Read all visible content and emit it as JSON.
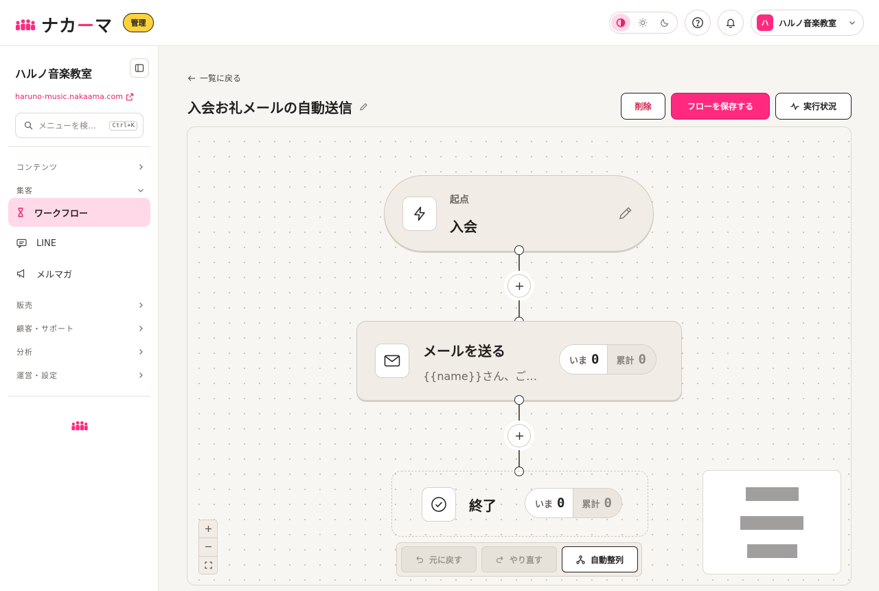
{
  "header": {
    "logo_text_a": "ナカ",
    "logo_text_b": "ー",
    "logo_text_c": "マ",
    "admin_badge": "管理",
    "account_initial": "ハ",
    "account_name": "ハルノ音楽教室"
  },
  "sidebar": {
    "org_name": "ハルノ音楽教室",
    "org_url": "haruno-music.nakaama.com",
    "search_placeholder": "メニューを検…",
    "search_shortcut": "Ctrl+K",
    "sections": [
      {
        "label": "コンテンツ"
      },
      {
        "label": "集客"
      },
      {
        "label": "販売"
      },
      {
        "label": "顧客・サポート"
      },
      {
        "label": "分析"
      },
      {
        "label": "運営・設定"
      }
    ],
    "items": [
      {
        "label": "ワークフロー",
        "icon": "hourglass-icon"
      },
      {
        "label": "LINE",
        "icon": "chat-icon"
      },
      {
        "label": "メルマガ",
        "icon": "megaphone-icon"
      }
    ]
  },
  "main": {
    "back_label": "一覧に戻る",
    "title": "入会お礼メールの自動送信",
    "delete_label": "削除",
    "save_label": "フローを保存する",
    "status_label": "実行状況"
  },
  "flow": {
    "start": {
      "caption": "起点",
      "label": "入会"
    },
    "mail": {
      "label": "メールを送る",
      "preview": "{{name}}さん、ご…",
      "now_label": "いま",
      "now": "0",
      "total_label": "累計",
      "total": "0"
    },
    "end": {
      "label": "終了",
      "now_label": "いま",
      "now": "0",
      "total_label": "累計",
      "total": "0"
    }
  },
  "toolbar": {
    "undo_label": "元に戻す",
    "redo_label": "やり直す",
    "auto_layout_label": "自動整列"
  },
  "colors": {
    "brand": "#ff2a7f",
    "badge": "#ffd23d",
    "active_nav": "#ffd9e8"
  }
}
